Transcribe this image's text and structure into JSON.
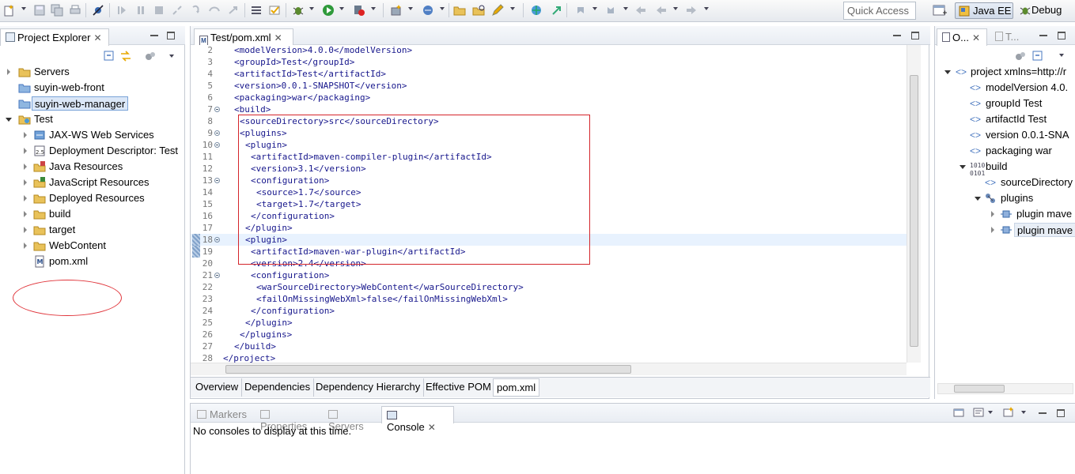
{
  "toolbar": {
    "quick_access_placeholder": "Quick Access",
    "perspectives": [
      {
        "label": "Java EE",
        "active": true,
        "icon": "javaee-perspective-icon"
      },
      {
        "label": "Debug",
        "active": false,
        "icon": "debug-perspective-icon"
      }
    ]
  },
  "project_explorer": {
    "title": "Project Explorer",
    "items": [
      {
        "label": "Servers"
      },
      {
        "label": "suyin-web-front"
      },
      {
        "label": "suyin-web-manager"
      },
      {
        "label": "Test"
      },
      {
        "label": "JAX-WS Web Services"
      },
      {
        "label": "Deployment Descriptor: Test"
      },
      {
        "label": "Java Resources"
      },
      {
        "label": "JavaScript Resources"
      },
      {
        "label": "Deployed Resources"
      },
      {
        "label": "build"
      },
      {
        "label": "target"
      },
      {
        "label": "WebContent"
      },
      {
        "label": "pom.xml"
      }
    ]
  },
  "editor": {
    "tab_title": "Test/pom.xml",
    "lines": [
      {
        "n": "2",
        "text": "<modelVersion>4.0.0</modelVersion>"
      },
      {
        "n": "3",
        "text": "<groupId>Test</groupId>"
      },
      {
        "n": "4",
        "text": "<artifactId>Test</artifactId>"
      },
      {
        "n": "5",
        "text": "<version>0.0.1-SNAPSHOT</version>"
      },
      {
        "n": "6",
        "text": "<packaging>war</packaging>"
      },
      {
        "n": "7",
        "text": "<build>"
      },
      {
        "n": "8",
        "text": "  <sourceDirectory>src</sourceDirectory>"
      },
      {
        "n": "9",
        "text": "  <plugins>"
      },
      {
        "n": "10",
        "text": "    <plugin>"
      },
      {
        "n": "11",
        "text": "      <artifactId>maven-compiler-plugin</artifactId>"
      },
      {
        "n": "12",
        "text": "      <version>3.1</version>"
      },
      {
        "n": "13",
        "text": "      <configuration>"
      },
      {
        "n": "14",
        "text": "        <source>1.7</source>"
      },
      {
        "n": "15",
        "text": "        <target>1.7</target>"
      },
      {
        "n": "16",
        "text": "      </configuration>"
      },
      {
        "n": "17",
        "text": "    </plugin>"
      },
      {
        "n": "18",
        "text": "    <plugin>"
      },
      {
        "n": "19",
        "text": "      <artifactId>maven-war-plugin</artifactId>"
      },
      {
        "n": "20",
        "text": "      <version>2.4</version>"
      },
      {
        "n": "21",
        "text": "      <configuration>"
      },
      {
        "n": "22",
        "text": "        <warSourceDirectory>WebContent</warSourceDirectory>"
      },
      {
        "n": "23",
        "text": "        <failOnMissingWebXml>false</failOnMissingWebXml>"
      },
      {
        "n": "24",
        "text": "      </configuration>"
      },
      {
        "n": "25",
        "text": "    </plugin>"
      },
      {
        "n": "26",
        "text": "  </plugins>"
      },
      {
        "n": "27",
        "text": "</build>"
      },
      {
        "n": "28",
        "text": "</project>"
      }
    ],
    "pom_tabs": [
      "Overview",
      "Dependencies",
      "Dependency Hierarchy",
      "Effective POM",
      "pom.xml"
    ]
  },
  "outline": {
    "tab1": "O...",
    "tab2": "T...",
    "items": [
      {
        "label": "project xmlns=http://r"
      },
      {
        "label": "modelVersion  4.0."
      },
      {
        "label": "groupId  Test"
      },
      {
        "label": "artifactId  Test"
      },
      {
        "label": "version  0.0.1-SNA"
      },
      {
        "label": "packaging  war"
      },
      {
        "label": "build"
      },
      {
        "label": "sourceDirectory"
      },
      {
        "label": "plugins"
      },
      {
        "label": "plugin  mave"
      },
      {
        "label": "plugin  mave"
      }
    ]
  },
  "console": {
    "tabs": [
      "Markers",
      "Properties",
      "Servers",
      "Console"
    ],
    "message": "No consoles to display at this time."
  }
}
